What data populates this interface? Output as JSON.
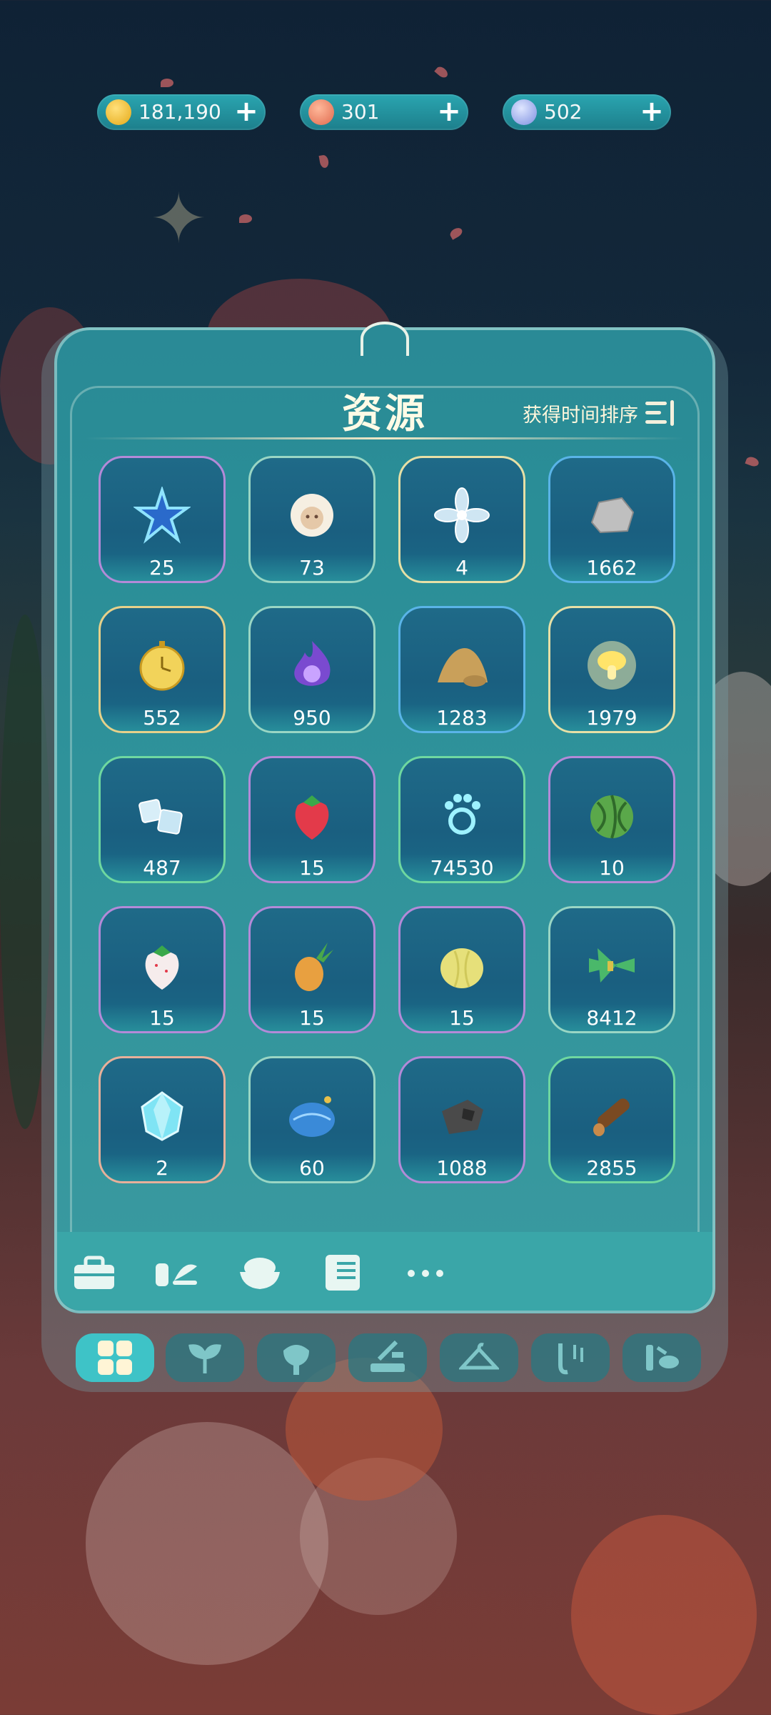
{
  "currencies": [
    {
      "name": "gold-coin",
      "value": "181,190",
      "plus": "+",
      "color": "#f3c232"
    },
    {
      "name": "flower-gem",
      "value": "301",
      "plus": "+",
      "color": "#e8896b"
    },
    {
      "name": "moon-token",
      "value": "502",
      "plus": "+",
      "color": "#8aa0e6"
    }
  ],
  "panel": {
    "title": "资源",
    "sort_label": "获得时间排序"
  },
  "items": [
    {
      "icon": "star-crystal-icon",
      "count": "25"
    },
    {
      "icon": "sheep-wool-icon",
      "count": "73"
    },
    {
      "icon": "crystal-flower-icon",
      "count": "4"
    },
    {
      "icon": "stone-icon",
      "count": "1662"
    },
    {
      "icon": "pocket-watch-icon",
      "count": "552"
    },
    {
      "icon": "purple-flame-icon",
      "count": "950"
    },
    {
      "icon": "sand-pile-icon",
      "count": "1283"
    },
    {
      "icon": "glowing-mushroom-icon",
      "count": "1979"
    },
    {
      "icon": "ice-cube-icon",
      "count": "487"
    },
    {
      "icon": "strawberry-icon",
      "count": "15"
    },
    {
      "icon": "paw-print-icon",
      "count": "74530"
    },
    {
      "icon": "watermelon-icon",
      "count": "10"
    },
    {
      "icon": "white-strawberry-icon",
      "count": "15"
    },
    {
      "icon": "pineapple-icon",
      "count": "15"
    },
    {
      "icon": "melon-icon",
      "count": "15"
    },
    {
      "icon": "grass-bundle-icon",
      "count": "8412"
    },
    {
      "icon": "diamond-icon",
      "count": "2"
    },
    {
      "icon": "blue-leaf-bundle-icon",
      "count": "60"
    },
    {
      "icon": "coal-icon",
      "count": "1088"
    },
    {
      "icon": "wood-log-icon",
      "count": "2855"
    }
  ],
  "category_bar": [
    "toolbox-icon",
    "sprout-tag-icon",
    "food-bowl-icon",
    "recipe-book-icon",
    "more-icon"
  ],
  "tabs": [
    "grid-icon",
    "seedling-icon",
    "lantern-icon",
    "workbench-icon",
    "hanger-icon",
    "music-icon",
    "fish-tool-icon"
  ]
}
